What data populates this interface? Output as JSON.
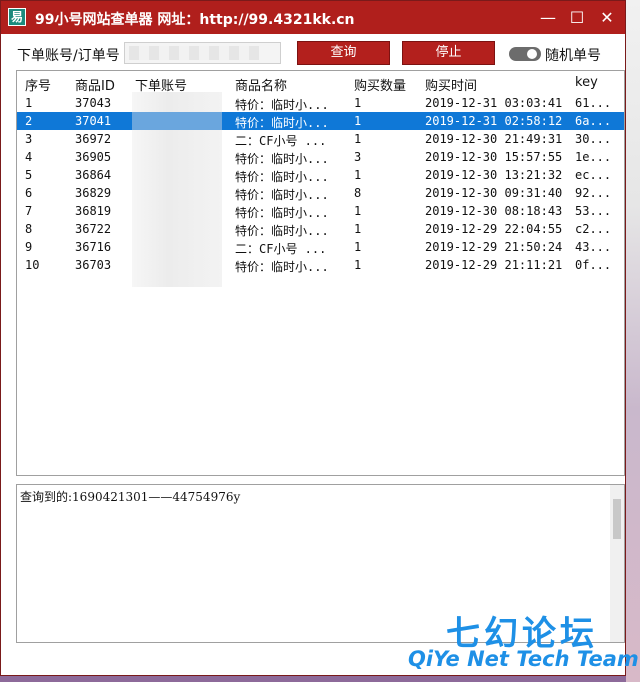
{
  "window": {
    "title": "99小号网站查单器 网址：http://99.4321kk.cn",
    "icon_glyph": "易"
  },
  "controls": {
    "minimize": "—",
    "maximize": "☐",
    "close": "✕"
  },
  "query": {
    "label": "下单账号/订单号",
    "input_value": "",
    "query_button": "查询",
    "stop_button": "停止",
    "random_toggle_label": "随机单号"
  },
  "table": {
    "columns": [
      "序号",
      "商品ID",
      "下单账号",
      "商品名称",
      "购买数量",
      "购买时间",
      "key"
    ],
    "selected_index": 1,
    "rows": [
      [
        "1",
        "37043",
        "",
        "特价：临时小...",
        "1",
        "2019-12-31 03:03:41",
        "61..."
      ],
      [
        "2",
        "37041",
        "",
        "特价：临时小...",
        "1",
        "2019-12-31 02:58:12",
        "6a..."
      ],
      [
        "3",
        "36972",
        "",
        "二：CF小号 ...",
        "1",
        "2019-12-30 21:49:31",
        "30..."
      ],
      [
        "4",
        "36905",
        "",
        "特价：临时小...",
        "3",
        "2019-12-30 15:57:55",
        "1e..."
      ],
      [
        "5",
        "36864",
        "",
        "特价：临时小...",
        "1",
        "2019-12-30 13:21:32",
        "ec..."
      ],
      [
        "6",
        "36829",
        "",
        "特价：临时小...",
        "8",
        "2019-12-30 09:31:40",
        "92..."
      ],
      [
        "7",
        "36819",
        "",
        "特价：临时小...",
        "1",
        "2019-12-30 08:18:43",
        "53..."
      ],
      [
        "8",
        "36722",
        "",
        "特价：临时小...",
        "1",
        "2019-12-29 22:04:55",
        "c2..."
      ],
      [
        "9",
        "36716",
        "",
        "二：CF小号 ...",
        "1",
        "2019-12-29 21:50:24",
        "43..."
      ],
      [
        "10",
        "36703",
        "",
        "特价：临时小...",
        "1",
        "2019-12-29 21:11:21",
        "0f..."
      ]
    ]
  },
  "log": {
    "text": "查询到的:1690421301——44754976y"
  },
  "watermark": {
    "cn": "七幻论坛",
    "en": "QiYe Net Tech Team"
  },
  "colors": {
    "titlebar": "#b01f1c",
    "button": "#b3201d",
    "selection": "#0f78d7",
    "watermark": "#1e90e6"
  }
}
